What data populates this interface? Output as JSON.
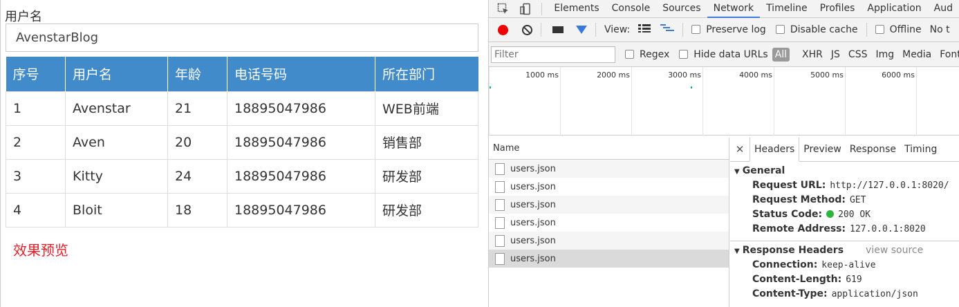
{
  "form": {
    "username_label": "用户名",
    "username_value": "AvenstarBlog"
  },
  "table": {
    "headers": [
      "序号",
      "用户名",
      "年龄",
      "电话号码",
      "所在部门"
    ],
    "rows": [
      [
        "1",
        "Avenstar",
        "21",
        "18895047986",
        "WEB前端"
      ],
      [
        "2",
        "Aven",
        "20",
        "18895047986",
        "销售部"
      ],
      [
        "3",
        "Kitty",
        "24",
        "18895047986",
        "研发部"
      ],
      [
        "4",
        "Bloit",
        "18",
        "18895047986",
        "研发部"
      ]
    ]
  },
  "preview_label": "效果预览",
  "devtools": {
    "tabs": [
      "Elements",
      "Console",
      "Sources",
      "Network",
      "Timeline",
      "Profiles",
      "Application",
      "Aud"
    ],
    "active_tab": "Network",
    "toolbar": {
      "view_label": "View:",
      "preserve_log": "Preserve log",
      "disable_cache": "Disable cache",
      "offline": "Offline",
      "throttle": "No t"
    },
    "filter": {
      "placeholder": "Filter",
      "regex": "Regex",
      "hide_data_urls": "Hide data URLs",
      "all": "All",
      "types": [
        "XHR",
        "JS",
        "CSS",
        "Img",
        "Media",
        "Font"
      ]
    },
    "timeline_labels": [
      "1000 ms",
      "2000 ms",
      "3000 ms",
      "4000 ms",
      "5000 ms",
      "6000 ms"
    ],
    "names_header": "Name",
    "requests": [
      "users.json",
      "users.json",
      "users.json",
      "users.json",
      "users.json",
      "users.json"
    ],
    "detail_tabs": [
      "Headers",
      "Preview",
      "Response",
      "Timing"
    ],
    "general": {
      "title": "General",
      "request_url_k": "Request URL:",
      "request_url_v": "http://127.0.0.1:8020/",
      "request_method_k": "Request Method:",
      "request_method_v": "GET",
      "status_code_k": "Status Code:",
      "status_code_v": "200 OK",
      "remote_address_k": "Remote Address:",
      "remote_address_v": "127.0.0.1:8020"
    },
    "response_headers": {
      "title": "Response Headers",
      "view_source": "view source",
      "connection_k": "Connection:",
      "connection_v": "keep-alive",
      "content_length_k": "Content-Length:",
      "content_length_v": "619",
      "content_type_k": "Content-Type:",
      "content_type_v": "application/json"
    }
  }
}
